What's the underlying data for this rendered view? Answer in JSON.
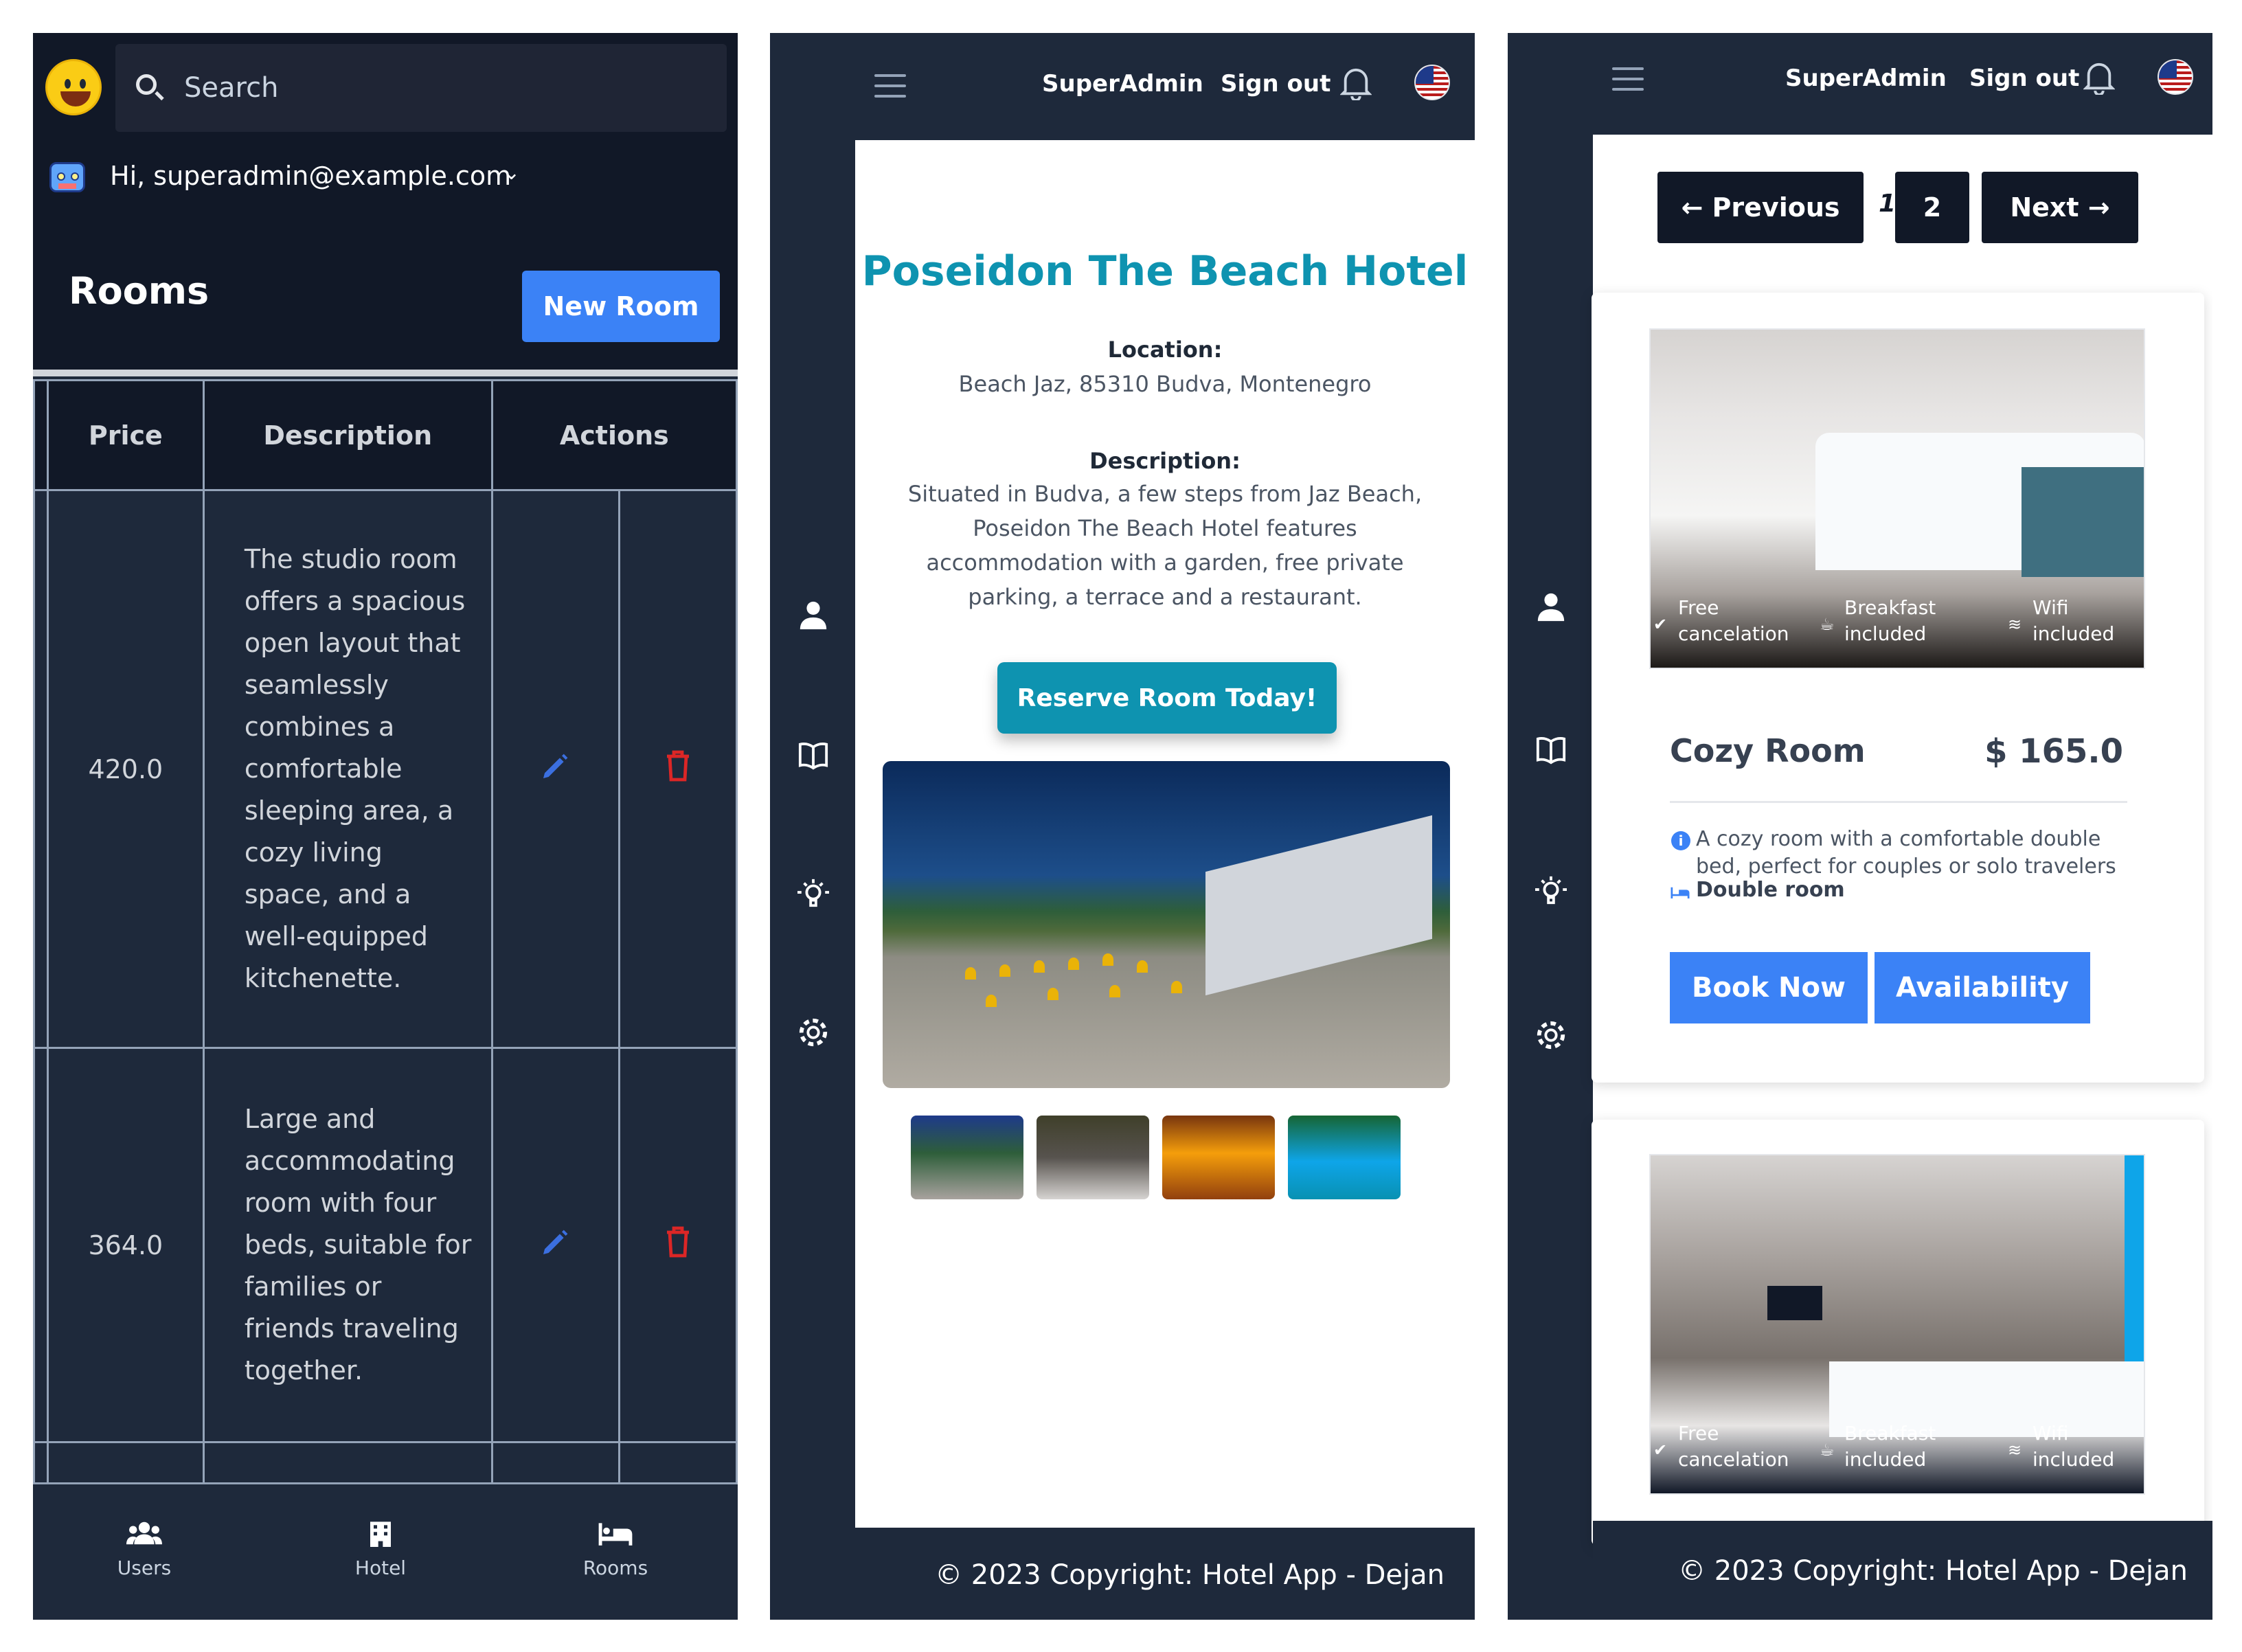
{
  "panel1": {
    "search": {
      "placeholder": "Search"
    },
    "user": {
      "greeting": "Hi, superadmin@example.com"
    },
    "page": {
      "title": "Rooms",
      "new_button": "New Room"
    },
    "table": {
      "headers": [
        "Price",
        "Description",
        "Actions"
      ],
      "rows": [
        {
          "price": "420.0",
          "description": "The studio room offers a spacious open layout that seamlessly combines a comfortable sleeping area, a cozy living space, and a well-equipped kitchenette."
        },
        {
          "price": "364.0",
          "description": "Large and accommodating room with four beds, suitable for families or friends traveling together."
        }
      ]
    },
    "bottom_nav": [
      {
        "label": "Users",
        "icon": "users-icon"
      },
      {
        "label": "Hotel",
        "icon": "hotel-icon"
      },
      {
        "label": "Rooms",
        "icon": "bed-icon"
      }
    ]
  },
  "panel2": {
    "nav": {
      "user": "SuperAdmin",
      "signout": "Sign out"
    },
    "hotel": {
      "name": "Poseidon The Beach Hotel",
      "location_label": "Location:",
      "location": "Beach Jaz, 85310 Budva, Montenegro",
      "description_label": "Description:",
      "description_lines": [
        "Situated in Budva, a few steps from Jaz Beach,",
        "Poseidon The Beach Hotel features",
        "accommodation with a garden, free private",
        "parking, a terrace and a restaurant."
      ],
      "reserve_button": "Reserve Room Today!"
    },
    "footer": "© 2023 Copyright: Hotel App - Dejan"
  },
  "panel3": {
    "nav": {
      "user": "SuperAdmin",
      "signout": "Sign out"
    },
    "pagination": {
      "previous": "← Previous",
      "current": "1",
      "page2": "2",
      "next": "Next →"
    },
    "facilities": {
      "cancel_1": "Free",
      "cancel_2": "cancelation",
      "breakfast_1": "Breakfast",
      "breakfast_2": "included",
      "wifi_1": "Wifi",
      "wifi_2": "included"
    },
    "room": {
      "name": "Cozy Room",
      "price": "$ 165.0",
      "description_lines": [
        "A cozy room with a comfortable double",
        "bed, perfect for couples or solo travelers"
      ],
      "type": "Double room",
      "book_button": "Book Now",
      "availability_button": "Availability"
    },
    "footer": "© 2023 Copyright: Hotel App - Dejan"
  },
  "colors": {
    "dark_bg": "#1e293b",
    "darker_bg": "#111827",
    "accent_blue": "#3b82f6",
    "accent_teal": "#0e93b0",
    "delete_red": "#dc2626"
  }
}
